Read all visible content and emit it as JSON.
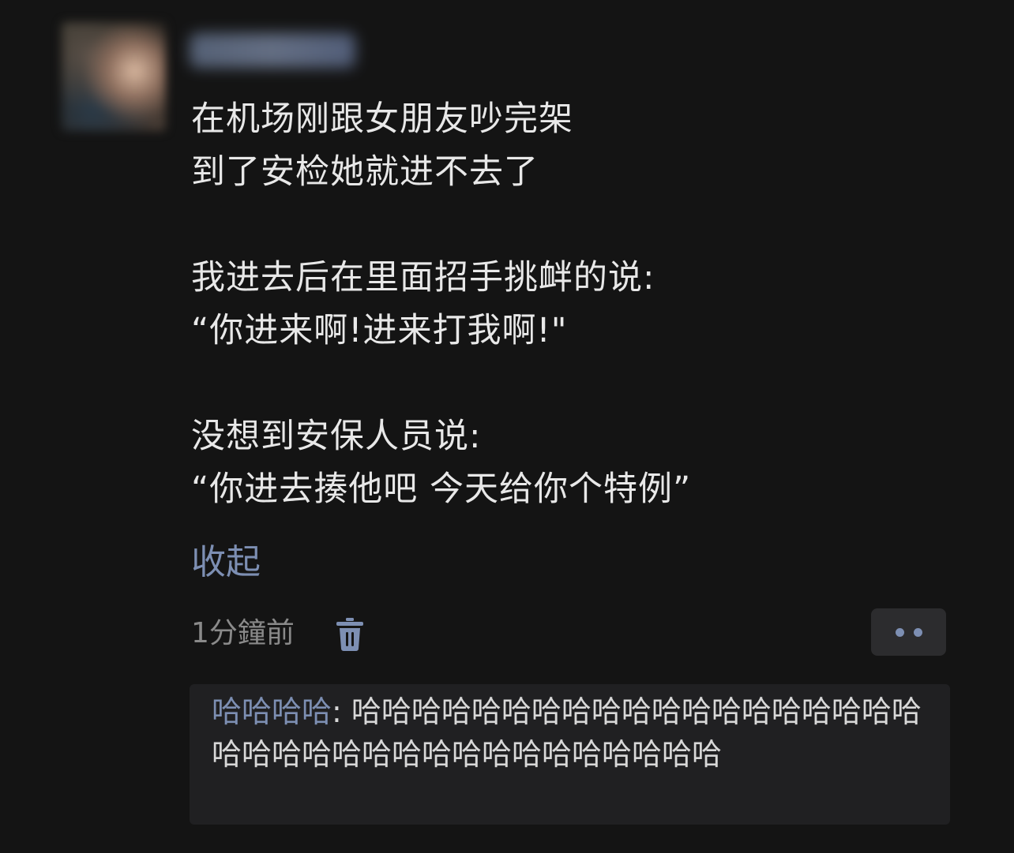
{
  "post": {
    "avatar": "blurred-profile-photo",
    "username": "",
    "lines": [
      "在机场刚跟女朋友吵完架",
      "到了安检她就进不去了",
      "",
      "我进去后在里面招手挑衅的说:",
      "“你进来啊!进来打我啊!\"",
      "",
      "没想到安保人员说:",
      "“你进去揍他吧 今天给你个特例”"
    ],
    "collapse_label": "收起",
    "timestamp": "1分鐘前",
    "delete_icon": "trash-icon",
    "more_icon": "more-dots-icon"
  },
  "comment": {
    "author": "哈哈哈哈",
    "separator": ": ",
    "text": "哈哈哈哈哈哈哈哈哈哈哈哈哈哈哈哈哈哈哈哈哈哈哈哈哈哈哈哈哈哈哈哈哈哈哈哈"
  },
  "colors": {
    "background": "#141414",
    "link": "#7d8fb3",
    "text": "#e8e8e8",
    "muted": "#8a8a8a",
    "panel": "#202022"
  }
}
